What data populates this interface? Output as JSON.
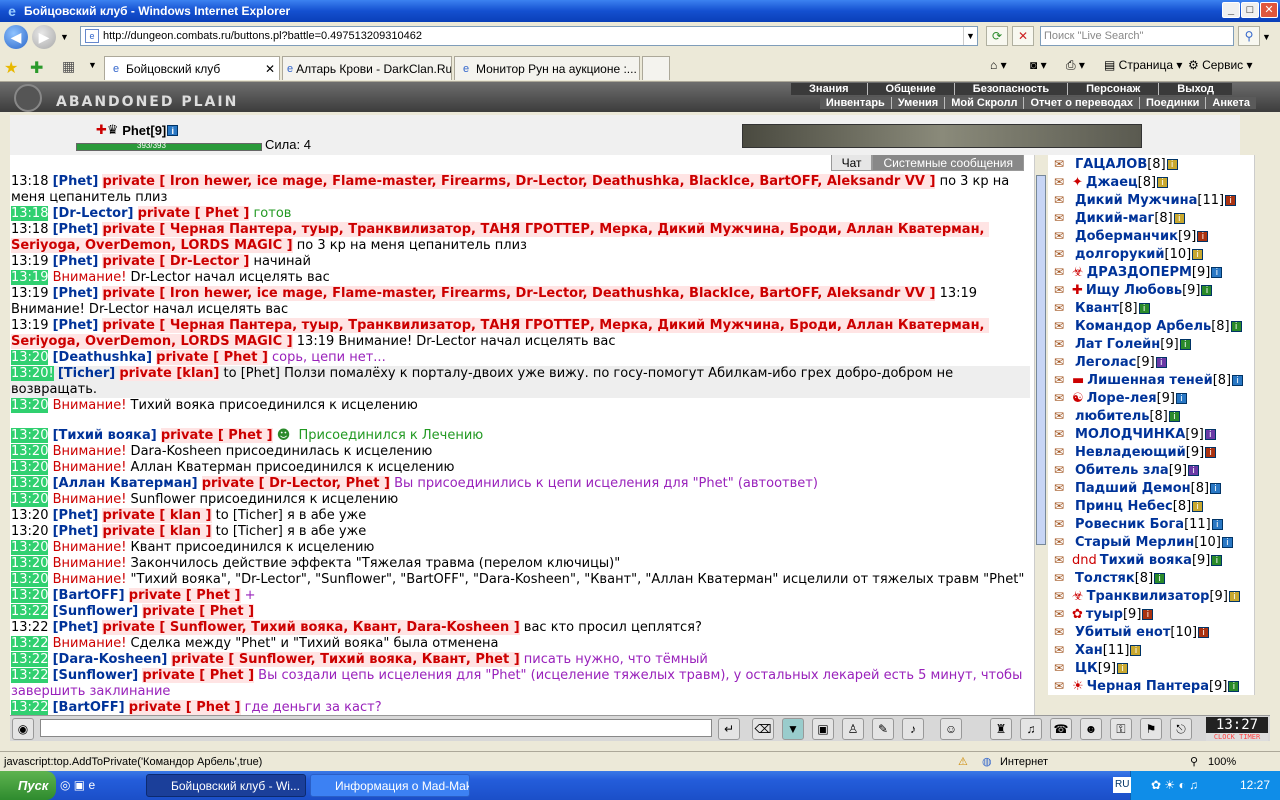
{
  "window": {
    "title": "Бойцовский клуб - Windows Internet Explorer",
    "min": "_",
    "max": "□",
    "close": "✕"
  },
  "address": {
    "url": "http://dungeon.combats.ru/buttons.pl?battle=0.497513209310462",
    "search_placeholder": "Поиск \"Live Search\""
  },
  "tabs": [
    {
      "label": "Бойцовский клуб",
      "close": "✕"
    },
    {
      "label": "Алтарь Крови - DarkClan.Ru"
    },
    {
      "label": "Монитор Рун на аукционе :..."
    }
  ],
  "toolbar": {
    "page_label": "Страница",
    "service_label": "Сервис"
  },
  "game": {
    "logo": "ABANDONED PLAIN",
    "menu1": [
      "Знания",
      "Общение",
      "Безопасность",
      "Персонаж",
      "Выход"
    ],
    "menu2": [
      "Инвентарь",
      "Умения",
      "Мой Скролл",
      "Отчет о переводах",
      "Поединки",
      "Анкета"
    ],
    "player": {
      "name": "Phet",
      "level": "[9]",
      "hp_text": "393/393",
      "sila": "Сила: 4"
    }
  },
  "chat": {
    "tab_chat": "Чат",
    "tab_system": "Системные сообщения",
    "lines": [
      {
        "ts": "13:18",
        "g": false,
        "nick": "[Phet]",
        "priv": "private [ Iron hewer, ice mage, Flame-master, Firearms, Dr-Lector, Deathushka, BlackIce, BartOFF, Aleksandr VV ]",
        "msg": " по 3 кр на меня цепанитель плиз",
        "cls": ""
      },
      {
        "ts": "13:18",
        "g": true,
        "nick": "[Dr-Lector]",
        "priv": "private [ Phet ]",
        "msg": " готов",
        "cls": "greenmsg"
      },
      {
        "ts": "13:18",
        "g": false,
        "nick": "[Phet]",
        "priv": "private [ Черная Пантера, туыр, Транквилизатор, ТАНЯ ГРОТТЕР, Мерка, Дикий Мужчина, Броди, Аллан Кватерман, Seriyoga, OverDemon, LORDS MAGIC ]",
        "msg": " по 3 кр на меня цепанитель плиз",
        "cls": ""
      },
      {
        "ts": "13:19",
        "g": false,
        "nick": "[Phet]",
        "priv": "private [ Dr-Lector ]",
        "msg": " начинай",
        "cls": ""
      },
      {
        "ts": "13:19",
        "g": true,
        "warn": "Внимание!",
        "msg": " Dr-Lector начал исцелять вас",
        "cls": ""
      },
      {
        "ts": "13:19",
        "g": false,
        "nick": "[Phet]",
        "priv": "private [ Iron hewer, ice mage, Flame-master, Firearms, Dr-Lector, Deathushka, BlackIce, BartOFF, Aleksandr VV ]",
        "msg": " 13:19 Внимание! Dr-Lector начал исцелять вас",
        "cls": ""
      },
      {
        "ts": "13:19",
        "g": false,
        "nick": "[Phet]",
        "priv": "private [ Черная Пантера, туыр, Транквилизатор, ТАНЯ ГРОТТЕР, Мерка, Дикий Мужчина, Броди, Аллан Кватерман, Seriyoga, OverDemon, LORDS MAGIC ]",
        "msg": " 13:19 Внимание! Dr-Lector начал исцелять вас",
        "cls": ""
      },
      {
        "ts": "13:20",
        "g": true,
        "nick": "[Deathushka]",
        "priv": "private [ Phet ]",
        "msg": " сорь, цепи нет...",
        "cls": "purplemsg"
      },
      {
        "ts": "13:20!",
        "g": true,
        "hl": true,
        "nick": "[Ticher]",
        "priv": "private [klan]",
        "msg": " to [Phet] Ползи помалёху к порталу-двоих уже вижу. по госу-помогут Абилкам-ибо грех добро-добром не возвращать.",
        "cls": ""
      },
      {
        "ts": "13:20",
        "g": true,
        "warn": "Внимание!",
        "msg": " Тихий вояка присоединился к исцелению",
        "cls": ""
      },
      {
        "ts": "13:20",
        "g": true,
        "nick": "[Тихий вояка]",
        "priv": "private [ Phet ]",
        "msg": "  Присоединился к Лечению",
        "cls": "greenmsg",
        "tall": true
      },
      {
        "ts": "13:20",
        "g": true,
        "warn": "Внимание!",
        "msg": " Dara-Kosheen присоединилась к исцелению",
        "cls": ""
      },
      {
        "ts": "13:20",
        "g": true,
        "warn": "Внимание!",
        "msg": " Аллан Кватерман присоединился к исцелению",
        "cls": ""
      },
      {
        "ts": "13:20",
        "g": true,
        "nick": "[Аллан Кватерман]",
        "priv": "private [ Dr-Lector, Phet ]",
        "msg": " Вы присоединились к цепи исцеления для \"Phet\" (автоответ)",
        "cls": "purplemsg"
      },
      {
        "ts": "13:20",
        "g": true,
        "warn": "Внимание!",
        "msg": " Sunflower присоединился к исцелению",
        "cls": ""
      },
      {
        "ts": "13:20",
        "g": false,
        "nick": "[Phet]",
        "priv": "private [ klan ]",
        "msg": " to [Ticher] я в абе уже",
        "cls": ""
      },
      {
        "ts": "13:20",
        "g": false,
        "nick": "[Phet]",
        "priv": "private [ klan ]",
        "msg": " to [Ticher] я в абе уже",
        "cls": ""
      },
      {
        "ts": "13:20",
        "g": true,
        "warn": "Внимание!",
        "msg": " Квант присоединился к исцелению",
        "cls": ""
      },
      {
        "ts": "13:20",
        "g": true,
        "warn": "Внимание!",
        "msg": " Закончилось действие эффекта \"Тяжелая травма (перелом ключицы)\"",
        "cls": ""
      },
      {
        "ts": "13:20",
        "g": true,
        "warn": "Внимание!",
        "msg": " \"Тихий вояка\", \"Dr-Lector\", \"Sunflower\", \"BartOFF\", \"Dara-Kosheen\", \"Квант\", \"Аллан Кватерман\" исцелили от тяжелых травм \"Phet\"",
        "cls": ""
      },
      {
        "ts": "13:20",
        "g": true,
        "nick": "[BartOFF]",
        "priv": "private [ Phet ]",
        "msg": " +",
        "cls": "purplemsg"
      },
      {
        "ts": "13:22",
        "g": true,
        "nick": "[Sunflower]",
        "priv": "private [ Phet ]",
        "msg": "",
        "cls": ""
      },
      {
        "ts": "13:22",
        "g": false,
        "nick": "[Phet]",
        "priv": "private [ Sunflower, Тихий вояка, Квант, Dara-Kosheen ]",
        "msg": " вас кто просил цеплятся?",
        "cls": ""
      },
      {
        "ts": "13:22",
        "g": true,
        "warn": "Внимание!",
        "msg": " Сделка между \"Phet\" и \"Тихий вояка\" была отменена",
        "cls": ""
      },
      {
        "ts": "13:22",
        "g": true,
        "nick": "[Dara-Kosheen]",
        "priv": "private [ Sunflower, Тихий вояка, Квант, Phet ]",
        "msg": " писать нужно, что тёмный",
        "cls": "purplemsg"
      },
      {
        "ts": "13:22",
        "g": true,
        "nick": "[Sunflower]",
        "priv": "private [ Phet ]",
        "msg": " Вы создали цепь исцеления для \"Phet\" (исцеление тяжелых травм), у остальных лекарей есть 5 минут, чтобы завершить заклинание",
        "cls": "purplemsg"
      },
      {
        "ts": "13:22",
        "g": true,
        "nick": "[BartOFF]",
        "priv": "private [ Phet ]",
        "msg": " где деньги за каст?",
        "cls": "purplemsg"
      }
    ]
  },
  "users": [
    {
      "sym": "",
      "name": "ГАЦАЛОВ",
      "lv": "[8]"
    },
    {
      "sym": "✦",
      "name": "Джаец",
      "lv": "[8]"
    },
    {
      "sym": "",
      "name": "Дикий Мужчина",
      "lv": "[11]"
    },
    {
      "sym": "",
      "name": "Дикий-маг",
      "lv": "[8]"
    },
    {
      "sym": "",
      "name": "Доберманчик",
      "lv": "[9]"
    },
    {
      "sym": "",
      "name": "долгорукий",
      "lv": "[10]"
    },
    {
      "sym": "☣",
      "name": "ДРАЗДОПЕРМ",
      "lv": "[9]"
    },
    {
      "sym": "✚",
      "name": "Ищу Любовь",
      "lv": "[9]"
    },
    {
      "sym": "",
      "name": "Квант",
      "lv": "[8]"
    },
    {
      "sym": "",
      "name": "Командор Арбель",
      "lv": "[8]"
    },
    {
      "sym": "",
      "name": "Лат Голейн",
      "lv": "[9]"
    },
    {
      "sym": "",
      "name": "Леголас",
      "lv": "[9]"
    },
    {
      "sym": "▬",
      "name": "Лишенная теней",
      "lv": "[8]"
    },
    {
      "sym": "☯",
      "name": "Лоре-лея",
      "lv": "[9]"
    },
    {
      "sym": "",
      "name": "любитель",
      "lv": "[8]"
    },
    {
      "sym": "",
      "name": "МОЛОДЧИНКА",
      "lv": "[9]"
    },
    {
      "sym": "",
      "name": "Невладеющий",
      "lv": "[9]"
    },
    {
      "sym": "",
      "name": "Обитель зла",
      "lv": "[9]"
    },
    {
      "sym": "",
      "name": "Падший Демон",
      "lv": "[8]"
    },
    {
      "sym": "",
      "name": "Принц Небес",
      "lv": "[8]"
    },
    {
      "sym": "",
      "name": "Ровесник Бога",
      "lv": "[11]"
    },
    {
      "sym": "",
      "name": "Старый Мерлин",
      "lv": "[10]"
    },
    {
      "sym": "dnd",
      "name": "Тихий вояка",
      "lv": "[9]"
    },
    {
      "sym": "",
      "name": "Толстяк",
      "lv": "[8]"
    },
    {
      "sym": "☣",
      "name": "Транквилизатор",
      "lv": "[9]"
    },
    {
      "sym": "✿",
      "name": "туыр",
      "lv": "[9]"
    },
    {
      "sym": "",
      "name": "Убитый енот",
      "lv": "[10]"
    },
    {
      "sym": "",
      "name": "Хан",
      "lv": "[11]"
    },
    {
      "sym": "",
      "name": "ЦК",
      "lv": "[9]"
    },
    {
      "sym": "☀",
      "name": "Черная Пантера",
      "lv": "[9]"
    }
  ],
  "clock": {
    "time": "13:27",
    "label": "CLOCK TIMER"
  },
  "status": {
    "text": "javascript:top.AddToPrivate('Командор Арбель',true)",
    "zone": "Интернет",
    "zoom": "100%"
  },
  "taskbar": {
    "start": "Пуск",
    "tasks": [
      "Бойцовский клуб - Wi...",
      "Информация о Mad-Mak..."
    ],
    "lang": "RU",
    "time": "12:27"
  }
}
